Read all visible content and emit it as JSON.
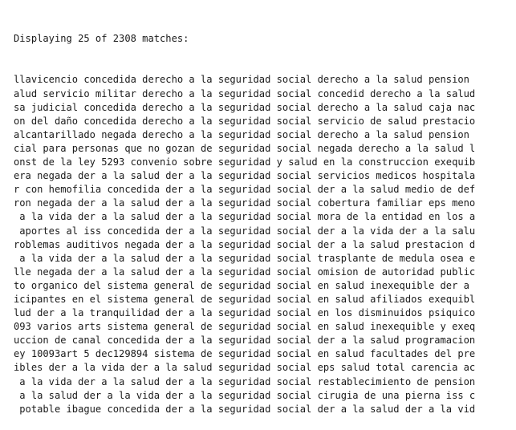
{
  "header": "Displaying 25 of 2308 matches:",
  "lines": [
    {
      "left": "llavicencio concedida derecho a la",
      "kw": "seguridad social",
      "right": "derecho a la salud pension"
    },
    {
      "left": "alud servicio militar derecho a la",
      "kw": "seguridad social",
      "right": "concedid derecho a la salud"
    },
    {
      "left": "sa judicial concedida derecho a la",
      "kw": "seguridad social",
      "right": "derecho a la salud caja nac"
    },
    {
      "left": "on del daño concedida derecho a la",
      "kw": "seguridad social",
      "right": "servicio de salud prestacio"
    },
    {
      "left": "alcantarillado negada derecho a la",
      "kw": "seguridad social",
      "right": "derecho a la salud pension"
    },
    {
      "left": "cial para personas que no gozan de",
      "kw": "seguridad social",
      "right": "negada derecho a la salud l"
    },
    {
      "left": "onst de la ley 5293 convenio sobre",
      "kw": "seguridad y",
      "right": "salud en la construccion exequib"
    },
    {
      "left": "era negada der a la salud der a la",
      "kw": "seguridad social",
      "right": "servicios medicos hospitala"
    },
    {
      "left": "r con hemofilia concedida der a la",
      "kw": "seguridad social",
      "right": "der a la salud medio de def"
    },
    {
      "left": "ron negada der a la salud der a la",
      "kw": "seguridad social",
      "right": "cobertura familiar eps meno"
    },
    {
      "left": " a la vida der a la salud der a la",
      "kw": "seguridad social",
      "right": "mora de la entidad en los a"
    },
    {
      "left": " aportes al iss concedida der a la",
      "kw": "seguridad social",
      "right": "der a la vida der a la salu"
    },
    {
      "left": "roblemas auditivos negada der a la",
      "kw": "seguridad social",
      "right": "der a la salud prestacion d"
    },
    {
      "left": " a la vida der a la salud der a la",
      "kw": "seguridad social",
      "right": "trasplante de medula osea e"
    },
    {
      "left": "lle negada der a la salud der a la",
      "kw": "seguridad social",
      "right": "omision de autoridad public"
    },
    {
      "left": "to organico del sistema general de",
      "kw": "seguridad social",
      "right": "en salud inexequible der a"
    },
    {
      "left": "icipantes en el sistema general de",
      "kw": "seguridad social",
      "right": "en salud afiliados exequibl"
    },
    {
      "left": "lud der a la tranquilidad der a la",
      "kw": "seguridad social",
      "right": "en los disminuidos psiquico"
    },
    {
      "left": "093 varios arts sistema general de",
      "kw": "seguridad social",
      "right": "en salud inexequible y exeq"
    },
    {
      "left": "uccion de canal concedida der a la",
      "kw": "seguridad social",
      "right": "der a la salud programacion"
    },
    {
      "left": "ey 10093art 5 dec129894 sistema de",
      "kw": "seguridad social",
      "right": "en salud facultades del pre"
    },
    {
      "left": "ibles der a la vida der a la salud",
      "kw": "seguridad social",
      "right": "eps salud total carencia ac"
    },
    {
      "left": " a la vida der a la salud der a la",
      "kw": "seguridad social",
      "right": "restablecimiento de pension"
    },
    {
      "left": " a la salud der a la vida der a la",
      "kw": "seguridad social",
      "right": "cirugia de una pierna iss c"
    },
    {
      "left": " potable ibague concedida der a la",
      "kw": "seguridad social",
      "right": "der a la salud der a la vid"
    }
  ]
}
